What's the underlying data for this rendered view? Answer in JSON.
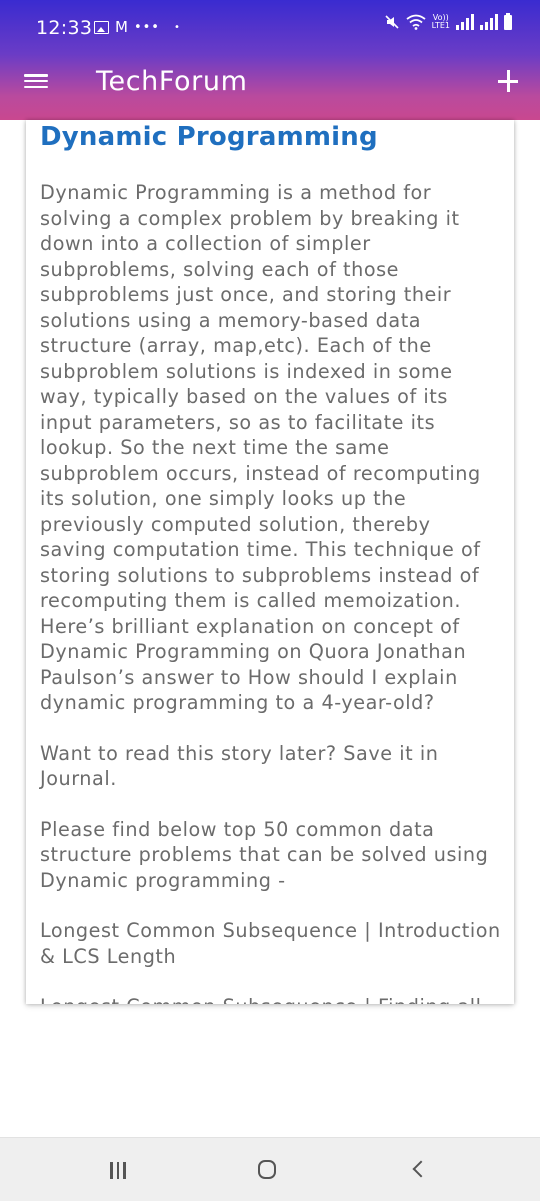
{
  "status_bar": {
    "time": "12:33",
    "left_icons": [
      "image-icon",
      "mail-icon",
      "more-dots-icon",
      "dot-icon"
    ],
    "mail_glyph": "M",
    "more_glyph": "•••",
    "dot_glyph": "•",
    "lte_top": "Vo))",
    "lte_bottom": "LTE1",
    "right_icons": [
      "mute-icon",
      "wifi-icon",
      "volte-icon",
      "signal-icon",
      "signal-roaming-icon",
      "battery-icon"
    ]
  },
  "app_bar": {
    "title": "TechForum",
    "menu_icon": "hamburger-menu-icon",
    "add_icon": "plus-icon"
  },
  "article": {
    "title": "Dynamic Programming",
    "paragraphs": [
      "Dynamic Programming is a method for solving a complex problem by breaking it down into a collection of simpler subproblems, solving each of those subproblems just once, and storing their solutions using a memory-based data structure (array, map,etc). Each of the subproblem solutions is indexed in some way, typically based on the values of its input parameters, so as to facilitate its lookup. So the next time the same subproblem occurs, instead of recomputing its solution, one simply looks up the previously computed solution, thereby saving computation time. This technique of storing solutions to subproblems instead of recomputing them is called memoization. Here’s brilliant explanation on concept of Dynamic Programming on Quora Jonathan Paulson’s answer to How should I explain dynamic programming to a 4-year-old?",
      "Want to read this story later? Save it in Journal.",
      "Please find below top 50 common data structure problems that can be solved using Dynamic programming -",
      "Longest Common Subsequence | Introduction & LCS Length"
    ],
    "cut_off_line": "Longest Common Subsequence | Finding all"
  },
  "nav_bar": {
    "recents_icon": "recents-icon",
    "home_icon": "home-icon",
    "back_icon": "back-icon"
  },
  "colors": {
    "gradient_top": "#3a2bd0",
    "gradient_bottom": "#c9488f",
    "title_blue": "#1f6fbf",
    "body_text": "#6b6b6b",
    "nav_bg": "#efefef"
  }
}
